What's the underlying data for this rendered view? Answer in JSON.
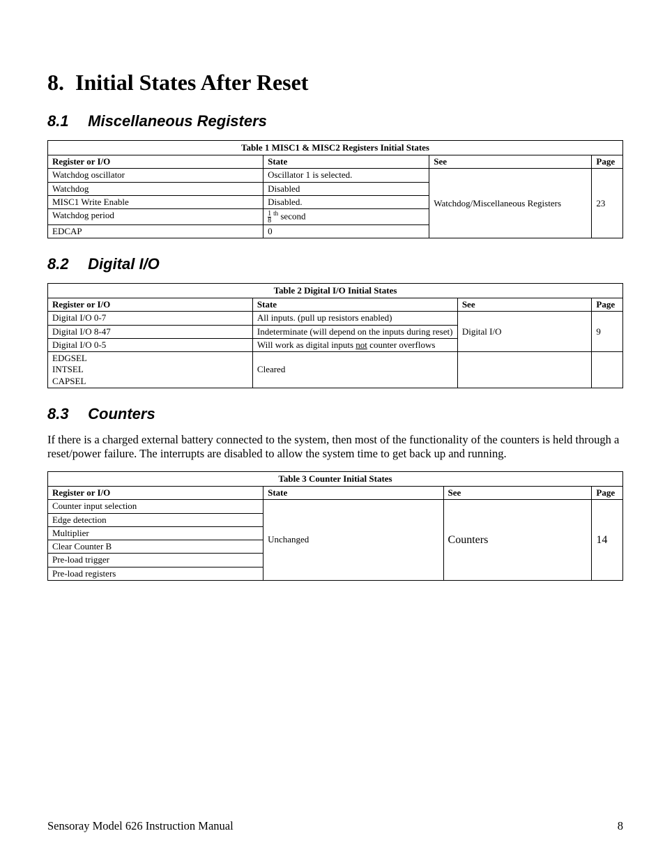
{
  "chapter": {
    "number": "8.",
    "title": "Initial States After Reset"
  },
  "sections": {
    "s1": {
      "num": "8.1",
      "title": "Miscellaneous Registers"
    },
    "s2": {
      "num": "8.2",
      "title": "Digital I/O"
    },
    "s3": {
      "num": "8.3",
      "title": "Counters"
    }
  },
  "table1": {
    "caption": "Table 1 MISC1 & MISC2 Registers Initial States",
    "head": {
      "c1": "Register or I/O",
      "c2": "State",
      "c3": "See",
      "c4": "Page"
    },
    "rows": [
      {
        "c1": "Watchdog oscillator",
        "c2": "Oscillator 1 is selected."
      },
      {
        "c1": "Watchdog",
        "c2": "Disabled"
      },
      {
        "c1": "MISC1 Write Enable",
        "c2": "Disabled."
      },
      {
        "c1": "Watchdog period",
        "c2_num": "1",
        "c2_den": "8",
        "c2_th": "th",
        "c2_rest": " second"
      },
      {
        "c1": "EDCAP",
        "c2": "0"
      }
    ],
    "see": "Watchdog/Miscellaneous Registers",
    "page": "23"
  },
  "table2": {
    "caption": "Table 2 Digital I/O Initial States",
    "head": {
      "c1": "Register or I/O",
      "c2": "State",
      "c3": "See",
      "c4": "Page"
    },
    "rows": [
      {
        "c1": "Digital I/O 0-7",
        "c2": "All inputs. (pull up resistors enabled)"
      },
      {
        "c1": "Digital I/O 8-47",
        "c2": "Indeterminate (will depend on the inputs during reset)"
      },
      {
        "c1": "Digital I/O 0-5",
        "c2_pre": "Will work as digital inputs ",
        "c2_u": "not",
        "c2_post": " counter overflows"
      }
    ],
    "see": "Digital I/O",
    "page": "9",
    "row4_lines": [
      "EDGSEL",
      "INTSEL",
      "CAPSEL"
    ],
    "row4_state": "Cleared"
  },
  "counters_para": "If there is a charged external battery connected to the system, then most of the functionality of the counters is held through a reset/power failure. The interrupts are disabled to allow the system time to get back up and running.",
  "table3": {
    "caption": "Table 3 Counter Initial States",
    "head": {
      "c1": "Register or I/O",
      "c2": "State",
      "c3": "See",
      "c4": "Page"
    },
    "rows": [
      {
        "c1": "Counter input selection"
      },
      {
        "c1": "Edge detection"
      },
      {
        "c1": "Multiplier"
      },
      {
        "c1": "Clear Counter B"
      },
      {
        "c1": "Pre-load trigger"
      },
      {
        "c1": "Pre-load registers"
      }
    ],
    "state": "Unchanged",
    "see": "Counters",
    "page": "14"
  },
  "footer": {
    "left": "Sensoray Model 626 Instruction Manual",
    "right": "8"
  }
}
